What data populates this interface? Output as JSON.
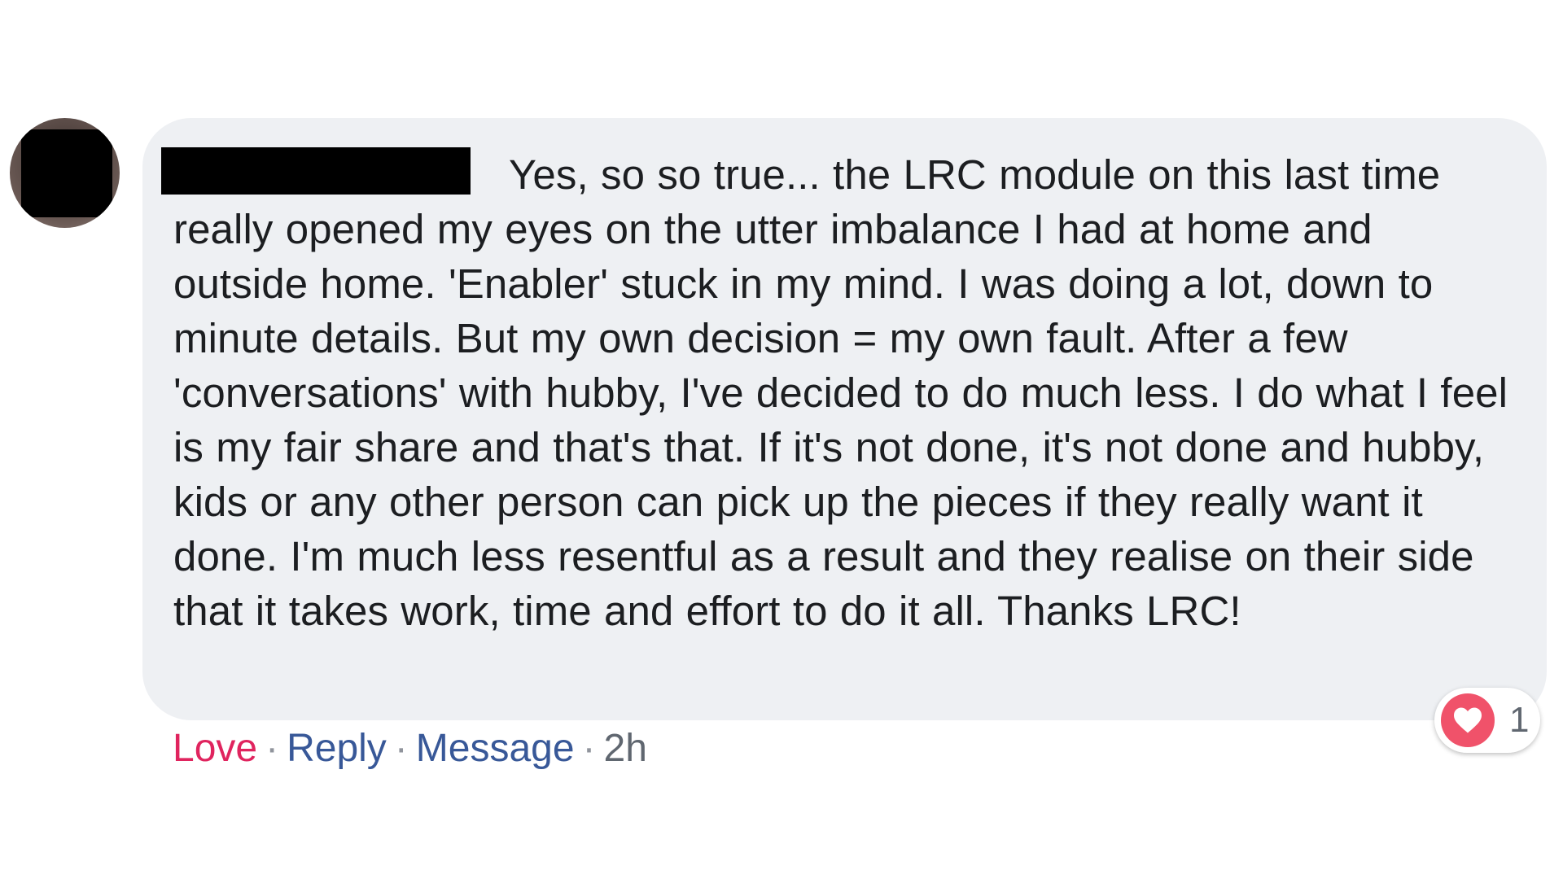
{
  "comment": {
    "text": "Yes, so so true... the LRC module on this last time really opened my eyes on the utter imbalance I had at home and outside home. 'Enabler' stuck in my mind. I was doing a lot, down to minute details. But my own decision = my own fault. After a few 'conversations' with hubby, I've decided to do much less. I do what I feel is my fair share and that's that. If it's not done, it's not done and hubby, kids or any other person can pick up the pieces if they really want it done. I'm much less resentful as a result and they realise on their side that it takes work, time and effort to do it all. Thanks LRC!",
    "bubble_color": "#eef0f3"
  },
  "actions": {
    "love_label": "Love",
    "reply_label": "Reply",
    "message_label": "Message",
    "separator": "·",
    "timestamp": "2h"
  },
  "reactions": {
    "icon": "heart-icon",
    "count": "1",
    "color": "#f0526a"
  },
  "colors": {
    "love": "#e0245e",
    "link": "#385898",
    "meta": "#606770"
  }
}
